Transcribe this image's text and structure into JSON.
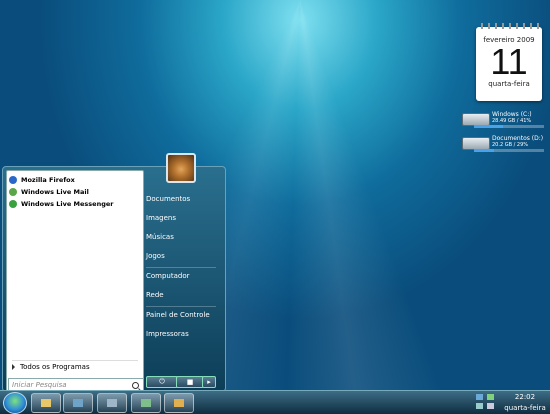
{
  "calendar": {
    "month": "fevereiro 2009",
    "day": "11",
    "weekday": "quarta-feira"
  },
  "drives": [
    {
      "name": "Windows (C:)",
      "info": "28.49 GB / 41%",
      "fill_percent": 41
    },
    {
      "name": "Documentos (D:)",
      "info": "20.2 GB / 29%",
      "fill_percent": 29
    }
  ],
  "start_menu": {
    "pinned": [
      {
        "label": "Mozilla Firefox",
        "icon": "firefox-icon",
        "color": "#2b67c9"
      },
      {
        "label": "Windows Live Mail",
        "icon": "live-mail-icon",
        "color": "#5aa64a"
      },
      {
        "label": "Windows Live Messenger",
        "icon": "messenger-icon",
        "color": "#3aa141"
      }
    ],
    "all_programs": "Todos os Programas",
    "search_placeholder": "Iniciar Pesquisa",
    "right_items": [
      "Documentos",
      "Imagens",
      "Músicas",
      "Jogos",
      "Computador",
      "Rede",
      "Painel de Controle",
      "Impressoras"
    ]
  },
  "taskbar": {
    "clock_time": "22:02",
    "clock_day": "quarta-feira",
    "buttons": [
      "explorer-icon",
      "media-icon",
      "tools-icon",
      "photo-icon",
      "player-icon"
    ]
  }
}
